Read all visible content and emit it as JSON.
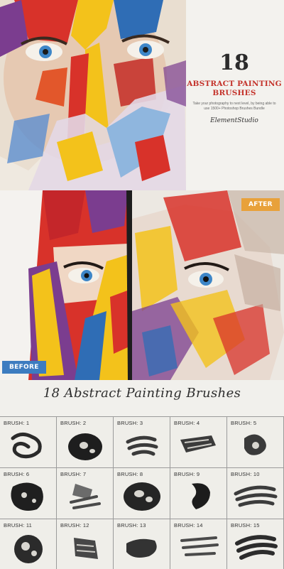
{
  "hero": {
    "number": "18",
    "title_line1": "ABSTRACT PAINTING",
    "title_line2": "BRUSHES",
    "subtitle": "Take your photography to next level, by being able to use 1500+ Photoshop Brushes Bundle",
    "signature": "ElementStudio"
  },
  "compare": {
    "before_label": "BEFORE",
    "after_label": "AFTER"
  },
  "grid": {
    "title": "18 Abstract Painting Brushes",
    "cells": [
      {
        "label": "BRUSH: 1"
      },
      {
        "label": "BRUSH: 2"
      },
      {
        "label": "BRUSH: 3"
      },
      {
        "label": "BRUSH: 4"
      },
      {
        "label": "BRUSH: 5"
      },
      {
        "label": "BRUSH: 6"
      },
      {
        "label": "BRUSH: 7"
      },
      {
        "label": "BRUSH: 8"
      },
      {
        "label": "BRUSH: 9"
      },
      {
        "label": "BRUSH: 10"
      },
      {
        "label": "BRUSH: 11"
      },
      {
        "label": "BRUSH: 12"
      },
      {
        "label": "BRUSH: 13"
      },
      {
        "label": "BRUSH: 14"
      },
      {
        "label": "BRUSH: 15"
      }
    ]
  },
  "colors": {
    "title_red": "#c4342c",
    "after_tag": "#e8a13a",
    "before_tag": "#3d7cc0",
    "paint_red": "#d8322a",
    "paint_yellow": "#f3c21b",
    "paint_blue": "#2f6db5",
    "paint_purple": "#7b3d8f",
    "eye_blue": "#3d86c8"
  }
}
